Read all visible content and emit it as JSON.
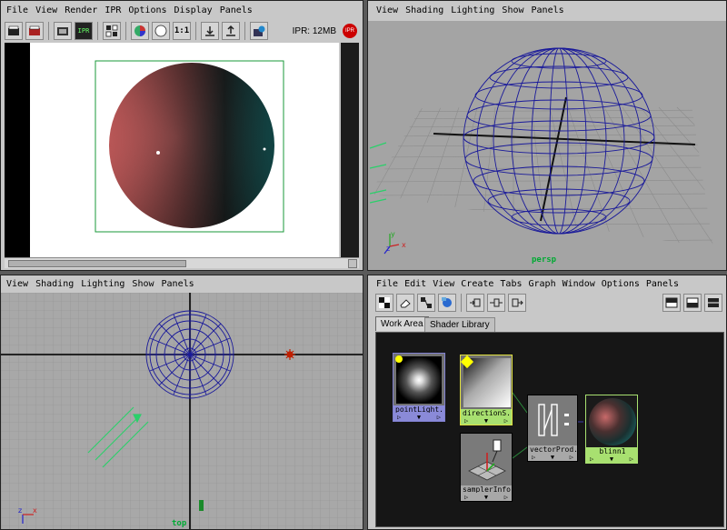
{
  "render_view": {
    "menu": [
      "File",
      "View",
      "Render",
      "IPR",
      "Options",
      "Display",
      "Panels"
    ],
    "ratio_label": "1:1",
    "ipr_status": "IPR: 12MB",
    "ipr_badge": "IPR"
  },
  "persp_view": {
    "menu": [
      "View",
      "Shading",
      "Lighting",
      "Show",
      "Panels"
    ],
    "camera_label": "persp",
    "axis_y": "y",
    "axis_z": "z",
    "axis_x": "x"
  },
  "top_view": {
    "menu": [
      "View",
      "Shading",
      "Lighting",
      "Show",
      "Panels"
    ],
    "camera_label": "top",
    "axis_z": "z",
    "axis_x": "x"
  },
  "hypershade": {
    "menu": [
      "File",
      "Edit",
      "View",
      "Create",
      "Tabs",
      "Graph",
      "Window",
      "Options",
      "Panels"
    ],
    "tabs": [
      "Work Area",
      "Shader Library"
    ],
    "nodes": {
      "point_light": "pointLight...",
      "directional": "directionS...",
      "vector_product": "vectorProd...",
      "blinn": "blinn1",
      "sampler_info": "samplerInfo1"
    },
    "node_foot_glyph": "▼",
    "node_port_glyph": "▷"
  },
  "colors": {
    "panel_bg": "#c8c8c8",
    "wire_blue": "#1a1a9a",
    "label_green": "#00aa33",
    "graph_bg": "#161616",
    "node_select": "#a8e070",
    "light_select": "#8080d0"
  }
}
